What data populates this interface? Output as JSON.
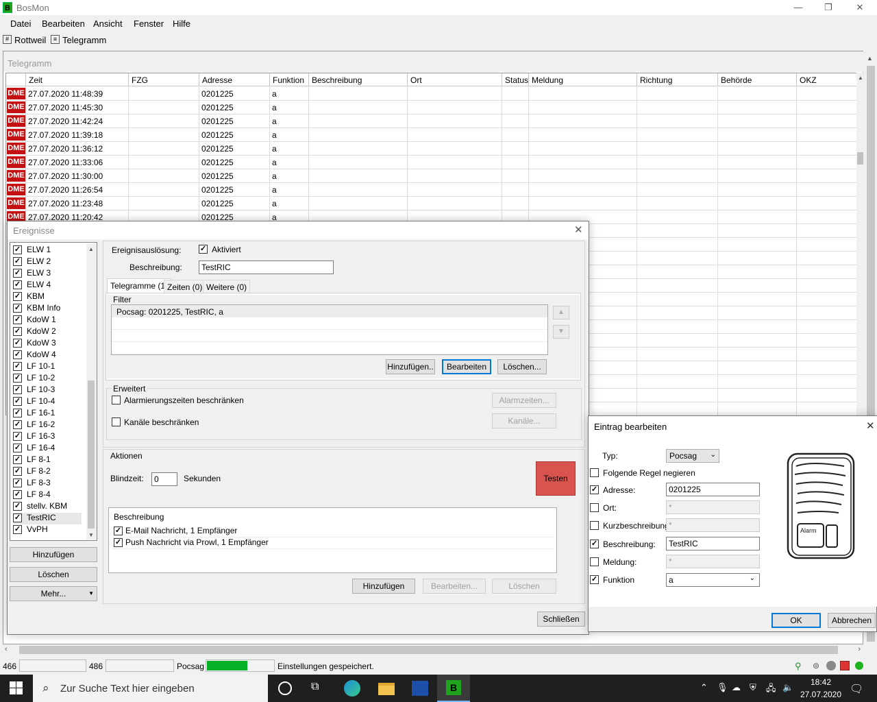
{
  "app": {
    "title": "BosMon",
    "logo": "B"
  },
  "window_buttons": {
    "minimize": "—",
    "restore": "❐",
    "close": "✕"
  },
  "menu": [
    "Datei",
    "Bearbeiten",
    "Ansicht",
    "Fenster",
    "Hilfe"
  ],
  "toolbar": {
    "rottweil": "Rottweil",
    "telegramm": "Telegramm"
  },
  "mdi": {
    "title": "Telegramm"
  },
  "grid": {
    "columns": [
      "Zeit",
      "FZG",
      "Adresse",
      "Funktion",
      "Beschreibung",
      "Ort",
      "Status",
      "Meldung",
      "Richtung",
      "Behörde",
      "OKZ"
    ],
    "badge": "DME",
    "rows": [
      {
        "zeit": "27.07.2020 11:48:39",
        "adresse": "0201225",
        "funktion": "a"
      },
      {
        "zeit": "27.07.2020 11:45:30",
        "adresse": "0201225",
        "funktion": "a"
      },
      {
        "zeit": "27.07.2020 11:42:24",
        "adresse": "0201225",
        "funktion": "a"
      },
      {
        "zeit": "27.07.2020 11:39:18",
        "adresse": "0201225",
        "funktion": "a"
      },
      {
        "zeit": "27.07.2020 11:36:12",
        "adresse": "0201225",
        "funktion": "a"
      },
      {
        "zeit": "27.07.2020 11:33:06",
        "adresse": "0201225",
        "funktion": "a"
      },
      {
        "zeit": "27.07.2020 11:30:00",
        "adresse": "0201225",
        "funktion": "a"
      },
      {
        "zeit": "27.07.2020 11:26:54",
        "adresse": "0201225",
        "funktion": "a"
      },
      {
        "zeit": "27.07.2020 11:23:48",
        "adresse": "0201225",
        "funktion": "a"
      },
      {
        "zeit": "27.07.2020 11:20:42",
        "adresse": "0201225",
        "funktion": "a"
      }
    ]
  },
  "ereignisse": {
    "title": "Ereignisse",
    "items": [
      "ELW 1",
      "ELW 2",
      "ELW 3",
      "ELW 4",
      "KBM",
      "KBM Info",
      "KdoW 1",
      "KdoW 2",
      "KdoW 3",
      "KdoW 4",
      "LF 10-1",
      "LF 10-2",
      "LF 10-3",
      "LF 10-4",
      "LF 16-1",
      "LF 16-2",
      "LF 16-3",
      "LF 16-4",
      "LF 8-1",
      "LF 8-2",
      "LF 8-3",
      "LF 8-4",
      "stellv. KBM",
      "TestRIC",
      "VvPH"
    ],
    "selected": "TestRIC",
    "btn_add": "Hinzufügen",
    "btn_delete": "Löschen",
    "btn_more": "Mehr...",
    "ausloesung_label": "Ereignisauslösung:",
    "aktiviert": "Aktiviert",
    "beschreibung_label": "Beschreibung:",
    "beschreibung_value": "TestRIC",
    "tabs": [
      "Telegramme (1)",
      "Zeiten (0)",
      "Weitere (0)"
    ],
    "filter_label": "Filter",
    "filter_items": [
      "Pocsag: 0201225, TestRIC, a"
    ],
    "filter_btns": [
      "Hinzufügen..",
      "Bearbeiten",
      "Löschen..."
    ],
    "erweitert_label": "Erweitert",
    "alarmzeiten_chk": "Alarmierungszeiten beschränken",
    "alarmzeiten_btn": "Alarmzeiten...",
    "kanaele_chk": "Kanäle beschränken",
    "kanaele_btn": "Kanäle...",
    "aktionen_label": "Aktionen",
    "blindzeit_label": "Blindzeit:",
    "blindzeit_value": "0",
    "sekunden": "Sekunden",
    "testen": "Testen",
    "aktionen_header": "Beschreibung",
    "aktionen_items": [
      "E-Mail Nachricht, 1 Empfänger",
      "Push Nachricht via Prowl, 1 Empfänger"
    ],
    "aktionen_btns": [
      "Hinzufügen",
      "Bearbeiten...",
      "Löschen"
    ],
    "close_btn": "Schließen"
  },
  "eintrag": {
    "title": "Eintrag bearbeiten",
    "typ_label": "Typ:",
    "typ_value": "Pocsag",
    "negieren": "Folgende Regel negieren",
    "fields": [
      {
        "label": "Adresse:",
        "value": "0201225",
        "checked": true
      },
      {
        "label": "Ort:",
        "value": "*",
        "checked": false
      },
      {
        "label": "Kurzbeschreibung:",
        "value": "*",
        "checked": false
      },
      {
        "label": "Beschreibung:",
        "value": "TestRIC",
        "checked": true
      },
      {
        "label": "Meldung:",
        "value": "*",
        "checked": false
      }
    ],
    "funktion_label": "Funktion",
    "funktion_value": "a",
    "pager_text": "Alarm",
    "ok": "OK",
    "abbrechen": "Abbrechen"
  },
  "statusbar": {
    "n1": "466",
    "n2": "486",
    "protocol": "Pocsag",
    "progress": 0.6,
    "message": "Einstellungen gespeichert."
  },
  "taskbar": {
    "search_placeholder": "Zur Suche Text hier eingeben",
    "time": "18:42",
    "date": "27.07.2020"
  }
}
